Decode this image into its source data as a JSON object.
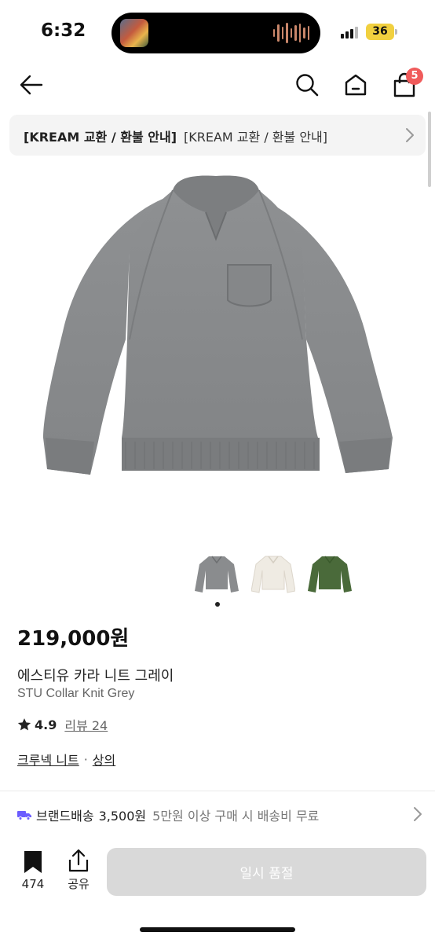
{
  "status_bar": {
    "time": "6:32",
    "battery": "36"
  },
  "header": {
    "cart_count": "5"
  },
  "notice": {
    "bold_text": "[KREAM 교환 / 환불 안내]",
    "text": "[KREAM 교환 / 환불 안내]"
  },
  "thumbnails": [
    {
      "name": "grey",
      "color": "#8a8c8e"
    },
    {
      "name": "ivory",
      "color": "#efebe3"
    },
    {
      "name": "green",
      "color": "#4a6a3a"
    }
  ],
  "product": {
    "price": "219,000원",
    "name_ko": "에스티유 카라 니트 그레이",
    "name_en": "STU Collar Knit Grey",
    "rating": "4.9",
    "review_label": "리뷰 24",
    "category_primary": "크루넥 니트",
    "category_separator": "·",
    "category_secondary": "상의"
  },
  "shipping": {
    "label": "브랜드배송",
    "price": "3,500원",
    "note": "5만원 이상 구매 시 배송비 무료"
  },
  "bottom_bar": {
    "bookmark_count": "474",
    "share_label": "공유",
    "button_label": "일시 품절"
  },
  "colors": {
    "badge": "#f05b5b",
    "truck": "#6b5cff",
    "button_disabled": "#d9d9d9"
  },
  "icons": [
    "back-arrow-icon",
    "search-icon",
    "home-icon",
    "shopping-bag-icon",
    "chevron-right-icon",
    "truck-icon",
    "bookmark-icon",
    "share-icon"
  ]
}
